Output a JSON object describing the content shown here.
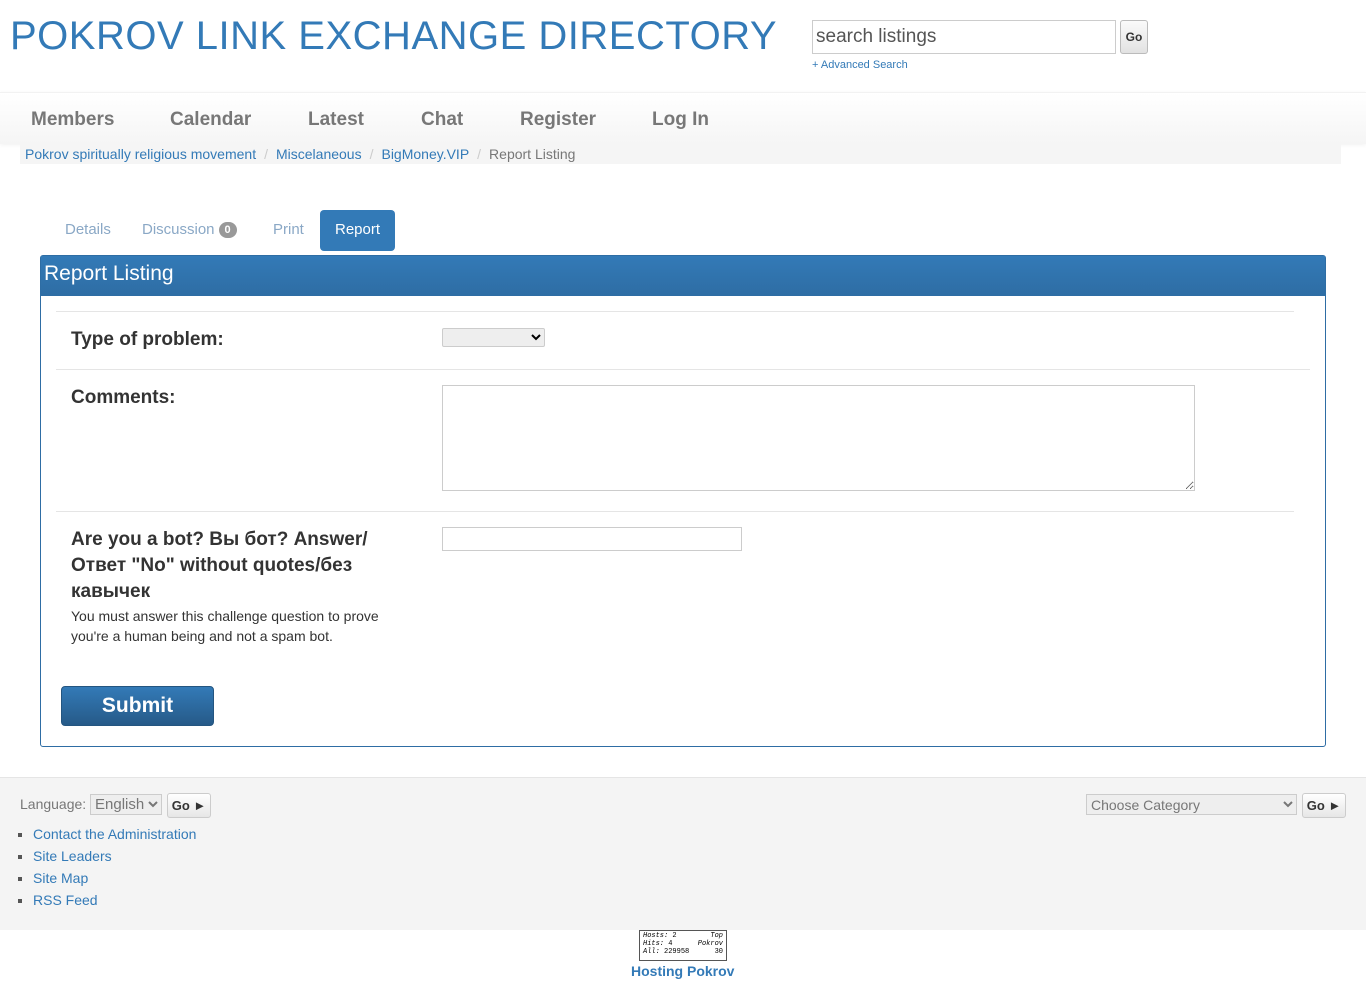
{
  "header": {
    "title": "POKROV LINK EXCHANGE DIRECTORY",
    "search_placeholder": "search listings",
    "search_go": "Go",
    "advanced_search": "+ Advanced Search"
  },
  "nav": {
    "items": [
      "Members",
      "Calendar",
      "Latest",
      "Chat",
      "Register",
      "Log In"
    ]
  },
  "breadcrumb": {
    "items": [
      "Pokrov spiritually religious movement",
      "Miscelaneous",
      "BigMoney.VIP"
    ],
    "current": "Report Listing",
    "separator": "/"
  },
  "tabs": {
    "details": "Details",
    "discussion": "Discussion",
    "discussion_count": "0",
    "print": "Print",
    "report": "Report"
  },
  "form": {
    "heading": "Report Listing",
    "problem_label": "Type of problem:",
    "comments_label": "Comments:",
    "bot_question": "Are you a bot? Вы бот? Answer/ Ответ \"No\" without quotes/без кавычек",
    "bot_help": "You must answer this challenge question to prove you're a human being and not a spam bot.",
    "submit": "Submit"
  },
  "footer": {
    "language_label": "Language:",
    "language_value": "English",
    "go_label": "Go ►",
    "category_placeholder": "Choose Category",
    "links": [
      "Contact the Administration",
      "Site Leaders",
      "Site Map",
      "RSS Feed"
    ],
    "counter": {
      "hosts_label": "Hosts:",
      "hosts_value": "2",
      "hits_label": "Hits:",
      "hits_value": "4",
      "all_label": "All:",
      "all_value": "229958",
      "top_label": "Top",
      "pokrov_label": "Pokrov",
      "rank": "30"
    },
    "hosting_link": "Hosting Pokrov"
  },
  "colors": {
    "primary": "#337ab7",
    "panel_border": "#2e6da4"
  }
}
